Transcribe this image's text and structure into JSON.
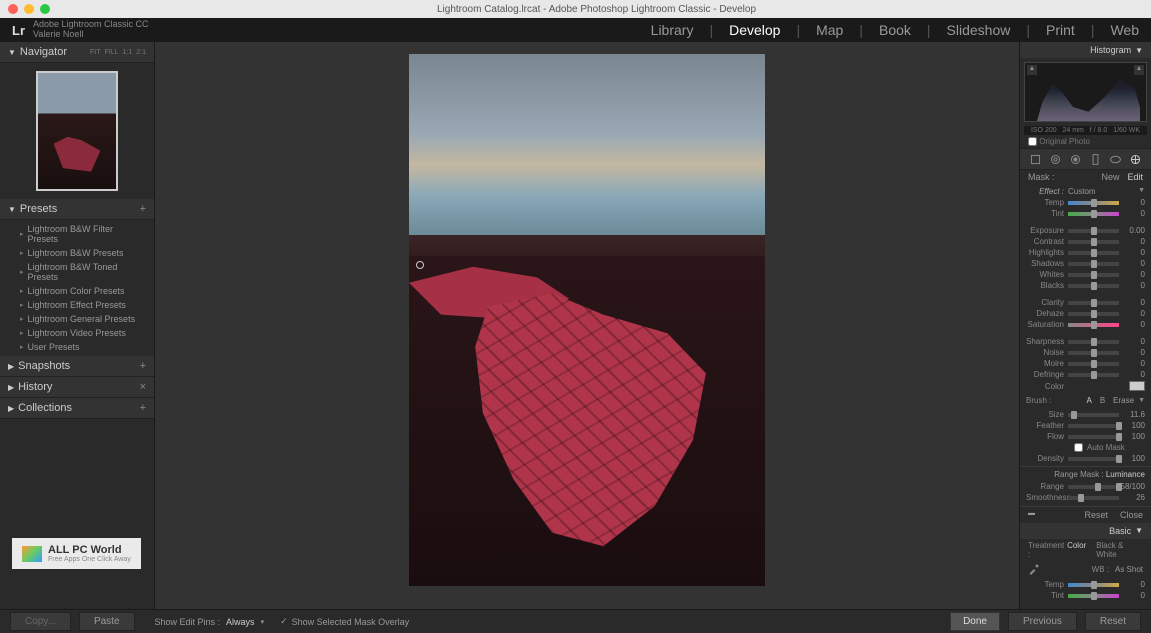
{
  "titlebar": {
    "title": "Lightroom Catalog.lrcat - Adobe Photoshop Lightroom Classic - Develop"
  },
  "identity": {
    "logo": "Lr",
    "product": "Adobe Lightroom Classic CC",
    "user": "Valerie Noell"
  },
  "modules": {
    "library": "Library",
    "develop": "Develop",
    "map": "Map",
    "book": "Book",
    "slideshow": "Slideshow",
    "print": "Print",
    "web": "Web"
  },
  "left": {
    "navigator": {
      "title": "Navigator",
      "ratios": [
        "FIT",
        "FILL",
        "1:1",
        "2:1"
      ]
    },
    "presets": {
      "title": "Presets",
      "items": [
        "Lightroom B&W Filter Presets",
        "Lightroom B&W Presets",
        "Lightroom B&W Toned Presets",
        "Lightroom Color Presets",
        "Lightroom Effect Presets",
        "Lightroom General Presets",
        "Lightroom Video Presets",
        "User Presets"
      ]
    },
    "snapshots": "Snapshots",
    "history": "History",
    "collections": "Collections",
    "watermark": {
      "title": "ALL PC World",
      "sub": "Free Apps One Click Away"
    }
  },
  "right": {
    "histogram": {
      "title": "Histogram",
      "meta": [
        "ISO 200",
        "24 mm",
        "f / 8.0",
        "1/60 WK"
      ],
      "original": "Original Photo"
    },
    "mask": {
      "label": "Mask :",
      "new": "New",
      "edit": "Edit"
    },
    "effect": {
      "label": "Effect :",
      "value": "Custom"
    },
    "sliders1": [
      {
        "key": "temp",
        "label": "Temp",
        "pos": 50,
        "val": "0",
        "grad": "grad-temp"
      },
      {
        "key": "tint",
        "label": "Tint",
        "pos": 50,
        "val": "0",
        "grad": "grad-tint"
      }
    ],
    "sliders2": [
      {
        "key": "exposure",
        "label": "Exposure",
        "pos": 50,
        "val": "0.00"
      },
      {
        "key": "contrast",
        "label": "Contrast",
        "pos": 50,
        "val": "0"
      },
      {
        "key": "highlights",
        "label": "Highlights",
        "pos": 50,
        "val": "0"
      },
      {
        "key": "shadows",
        "label": "Shadows",
        "pos": 50,
        "val": "0"
      },
      {
        "key": "whites",
        "label": "Whites",
        "pos": 50,
        "val": "0"
      },
      {
        "key": "blacks",
        "label": "Blacks",
        "pos": 50,
        "val": "0"
      }
    ],
    "sliders3": [
      {
        "key": "clarity",
        "label": "Clarity",
        "pos": 50,
        "val": "0"
      },
      {
        "key": "dehaze",
        "label": "Dehaze",
        "pos": 50,
        "val": "0"
      },
      {
        "key": "saturation",
        "label": "Saturation",
        "pos": 50,
        "val": "0",
        "grad": "grad-sat"
      }
    ],
    "sliders4": [
      {
        "key": "sharpness",
        "label": "Sharpness",
        "pos": 50,
        "val": "0"
      },
      {
        "key": "noise",
        "label": "Noise",
        "pos": 50,
        "val": "0"
      },
      {
        "key": "moire",
        "label": "Moire",
        "pos": 50,
        "val": "0"
      },
      {
        "key": "defringe",
        "label": "Defringe",
        "pos": 50,
        "val": "0"
      }
    ],
    "color": "Color",
    "brush": {
      "label": "Brush :",
      "a": "A",
      "b": "B",
      "erase": "Erase",
      "size": {
        "label": "Size",
        "pos": 12,
        "val": "11.6"
      },
      "feather": {
        "label": "Feather",
        "pos": 100,
        "val": "100"
      },
      "flow": {
        "label": "Flow",
        "pos": 100,
        "val": "100"
      },
      "automask": "Auto Mask",
      "density": {
        "label": "Density",
        "pos": 100,
        "val": "100"
      }
    },
    "rangemask": {
      "label": "Range Mask :",
      "mode": "Luminance",
      "range": {
        "label": "Range",
        "val": "58/100"
      },
      "smoothness": {
        "label": "Smoothness",
        "pos": 26,
        "val": "26"
      }
    },
    "reset": "Reset",
    "close": "Close",
    "basic": {
      "title": "Basic",
      "treatment": {
        "label": "Treatment :",
        "color": "Color",
        "bw": "Black & White"
      },
      "wb": {
        "label": "WB :",
        "value": "As Shot"
      },
      "temp": {
        "label": "Temp",
        "val": "0"
      },
      "tint": {
        "label": "Tint",
        "val": "0"
      }
    }
  },
  "footer": {
    "copy": "Copy...",
    "paste": "Paste",
    "pins_label": "Show Edit Pins :",
    "pins_value": "Always",
    "overlay": "Show Selected Mask Overlay",
    "done": "Done",
    "previous": "Previous",
    "reset": "Reset"
  }
}
